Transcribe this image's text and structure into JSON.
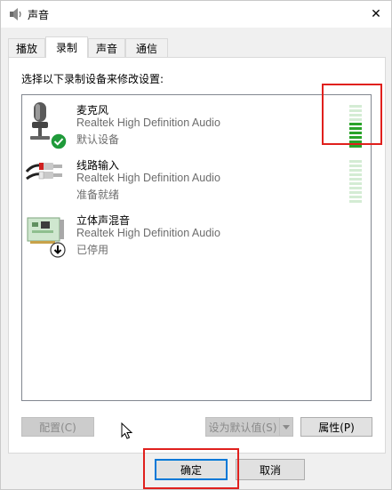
{
  "window": {
    "title": "声音",
    "close_glyph": "✕"
  },
  "tabs": [
    {
      "label": "播放",
      "active": false
    },
    {
      "label": "录制",
      "active": true
    },
    {
      "label": "声音",
      "active": false
    },
    {
      "label": "通信",
      "active": false
    }
  ],
  "panel": {
    "instruction": "选择以下录制设备来修改设置:"
  },
  "devices": [
    {
      "name": "麦克风",
      "driver": "Realtek High Definition Audio",
      "status": "默认设备",
      "icon": "microphone-icon",
      "badge": "default-check-icon",
      "meter_level": 0.6
    },
    {
      "name": "线路输入",
      "driver": "Realtek High Definition Audio",
      "status": "准备就绪",
      "icon": "line-in-cable-icon",
      "meter_level": 0
    },
    {
      "name": "立体声混音",
      "driver": "Realtek High Definition Audio",
      "status": "已停用",
      "icon": "sound-card-icon",
      "badge": "disabled-arrow-icon"
    }
  ],
  "buttons": {
    "configure": "配置(C)",
    "set_default": "设为默认值(S)",
    "properties": "属性(P)",
    "ok": "确定",
    "cancel": "取消"
  },
  "colors": {
    "meter_active": "#2aa32a",
    "meter_inactive": "#d4ecd4",
    "highlight": "#e0201d",
    "default_border": "#0078d7"
  }
}
